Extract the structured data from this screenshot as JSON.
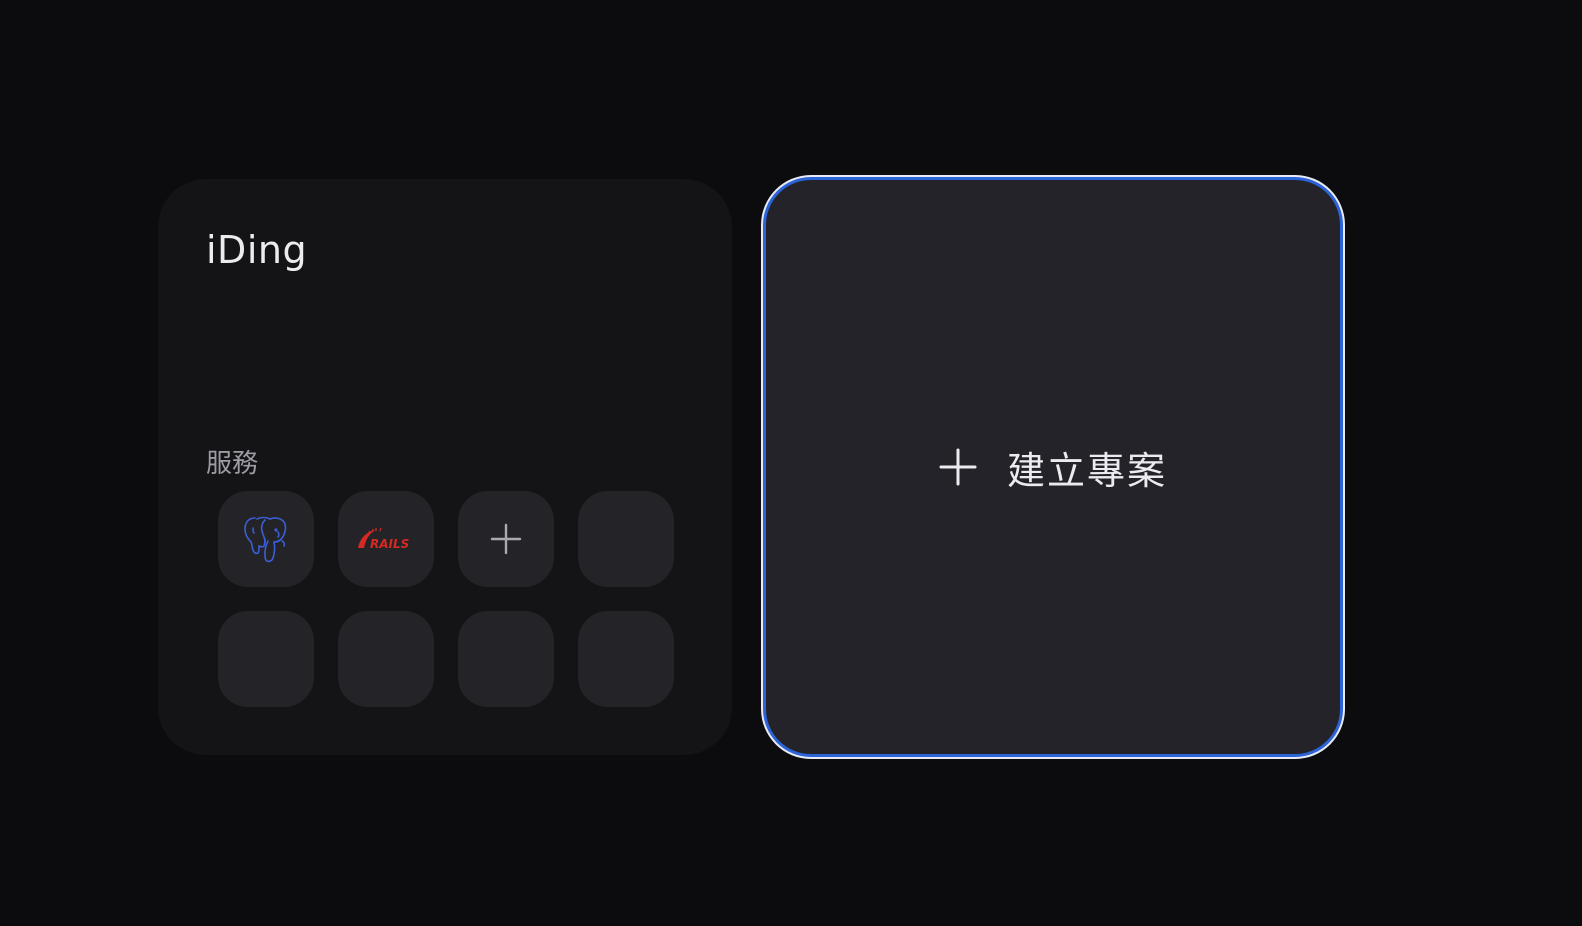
{
  "project": {
    "title": "iDing",
    "services_label": "服務",
    "services": [
      {
        "icon": "postgresql-elephant-icon",
        "color": "#3b5fd6"
      },
      {
        "icon": "rails-logo-icon",
        "text": "RAILS",
        "color": "#d42a23"
      },
      {
        "icon": "plus-icon",
        "color": "#a9a9b0"
      },
      {
        "icon": "empty"
      },
      {
        "icon": "empty"
      },
      {
        "icon": "empty"
      },
      {
        "icon": "empty"
      },
      {
        "icon": "empty"
      }
    ]
  },
  "create_project": {
    "label": "建立專案",
    "icon": "plus-icon",
    "border_color": "#2c63d6"
  }
}
